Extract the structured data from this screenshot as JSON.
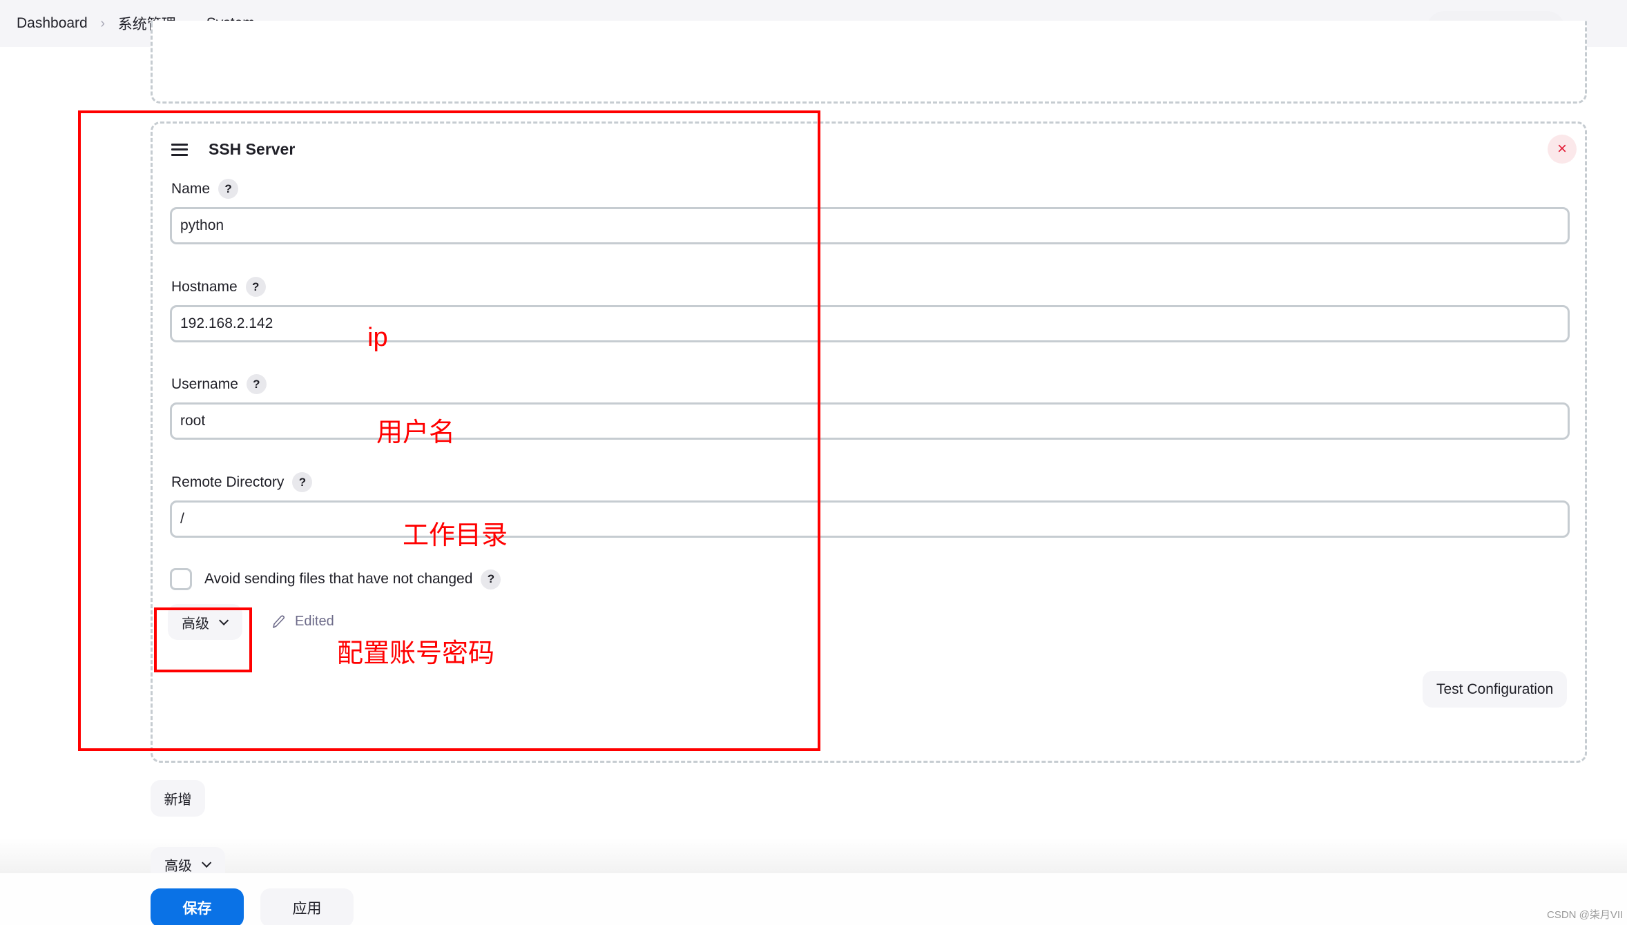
{
  "breadcrumb": {
    "items": [
      "Dashboard",
      "系统管理",
      "System"
    ],
    "separator": ">"
  },
  "ssh_server": {
    "title": "SSH Server",
    "close_icon": "×",
    "fields": {
      "name": {
        "label": "Name",
        "value": "python"
      },
      "hostname": {
        "label": "Hostname",
        "value": "192.168.2.142"
      },
      "username": {
        "label": "Username",
        "value": "root"
      },
      "remote_directory": {
        "label": "Remote Directory",
        "value": "/"
      }
    },
    "help_glyph": "?",
    "avoid_sending": {
      "label": "Avoid sending files that have not changed",
      "checked": false
    },
    "advanced_label": "高级",
    "edited_label": "Edited",
    "test_configuration_label": "Test Configuration"
  },
  "actions": {
    "add_label": "新增",
    "advanced_label": "高级",
    "save_label": "保存",
    "apply_label": "应用"
  },
  "annotations": {
    "ip": "ip",
    "username": "用户名",
    "workdir": "工作目录",
    "credentials": "配置账号密码",
    "color": "#ff0000"
  },
  "watermark": "CSDN @柒月VII",
  "colors": {
    "primary": "#0a72e6",
    "danger": "#e3203a",
    "border": "#c6ccd1",
    "button_bg": "#f5f5f8"
  }
}
